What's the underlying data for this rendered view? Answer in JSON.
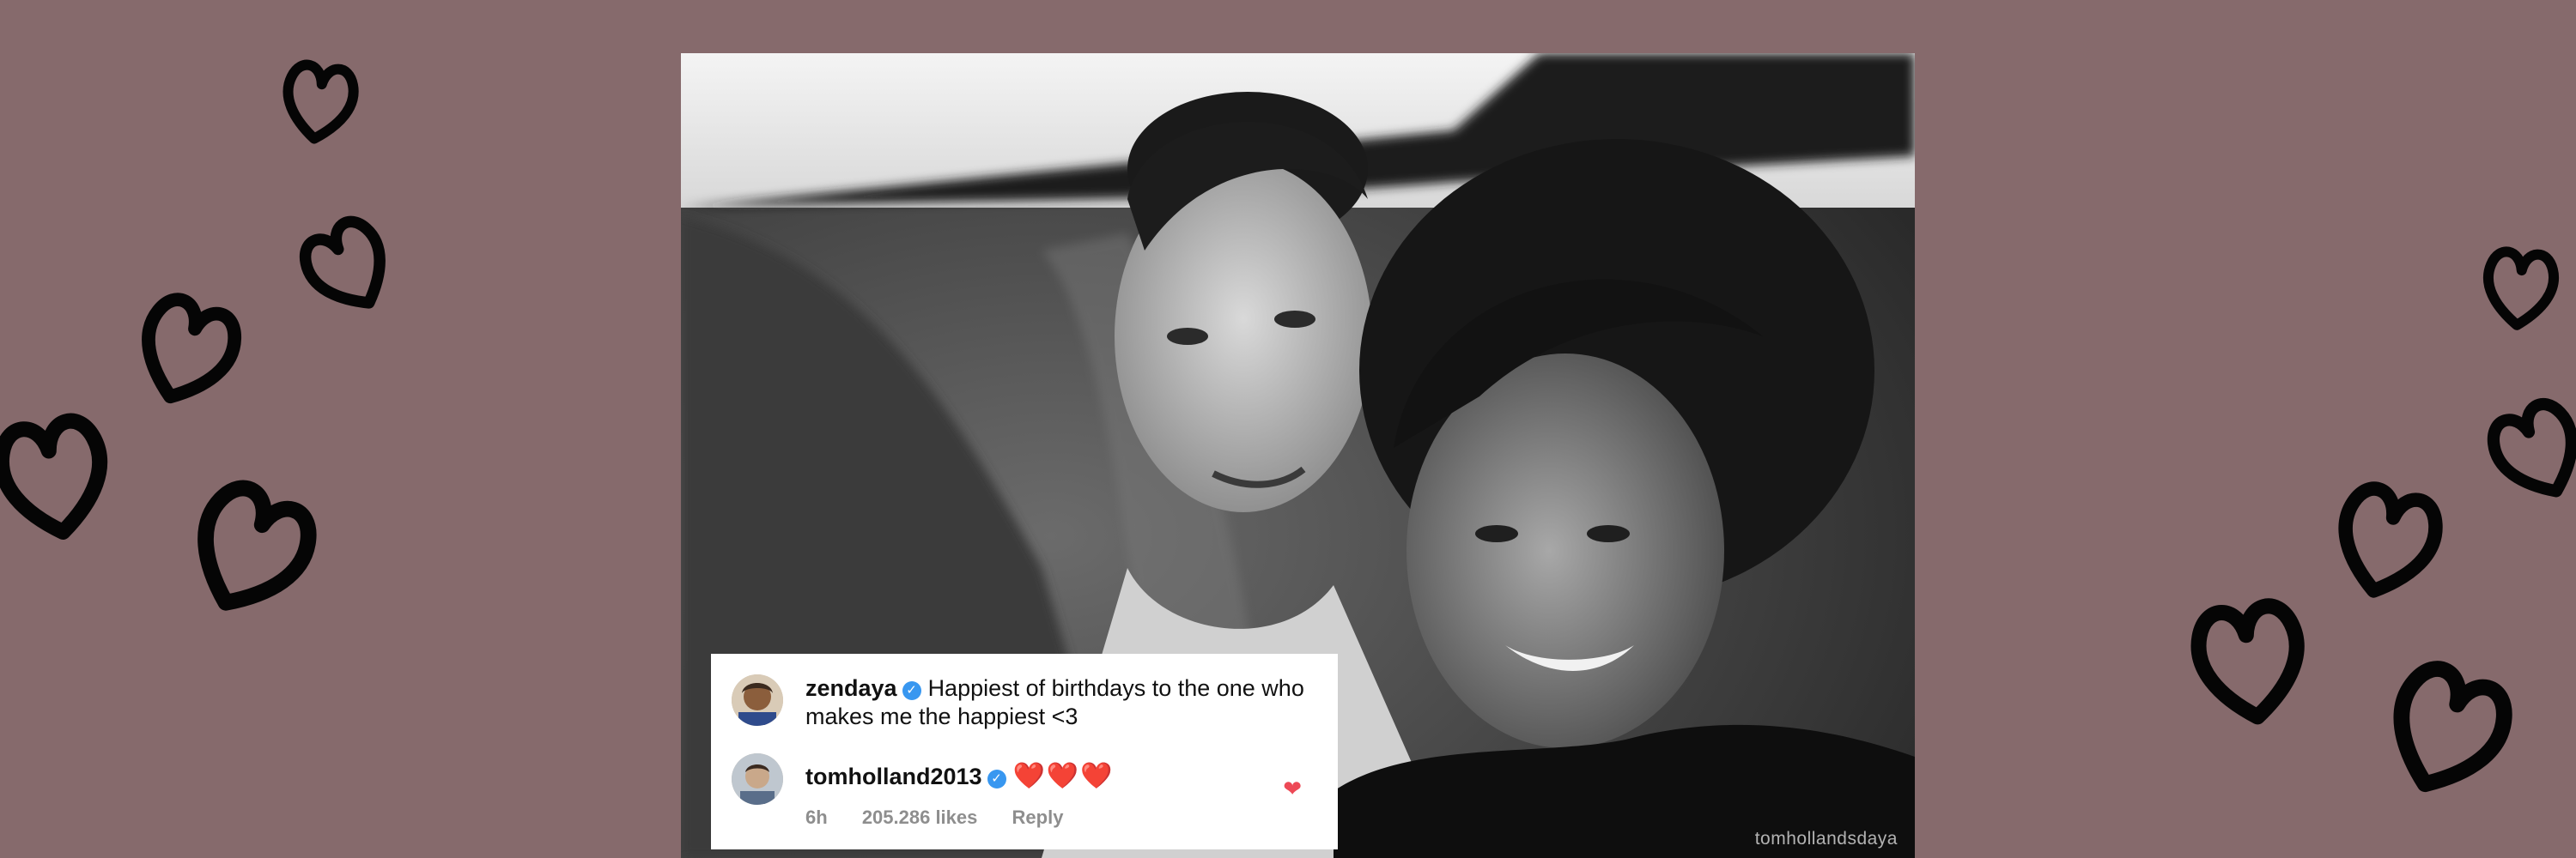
{
  "background_color": "#866a6c",
  "decoration": {
    "icon": "hand-drawn-heart-icon",
    "color": "#050505"
  },
  "photo": {
    "description_icon": "black-and-white-couple-photo",
    "watermark": "tomhollandsdaya"
  },
  "comments": [
    {
      "username": "zendaya",
      "verified": true,
      "text": "Happiest of birthdays to the one who makes me the happiest <3"
    },
    {
      "username": "tomholland2013",
      "verified": true,
      "text": "❤️❤️❤️",
      "time": "6h",
      "likes": "205.286 likes",
      "reply_label": "Reply",
      "like_icon": "heart-filled-icon"
    }
  ],
  "accent_colors": {
    "verified": "#3897f0",
    "like": "#ed4956"
  }
}
